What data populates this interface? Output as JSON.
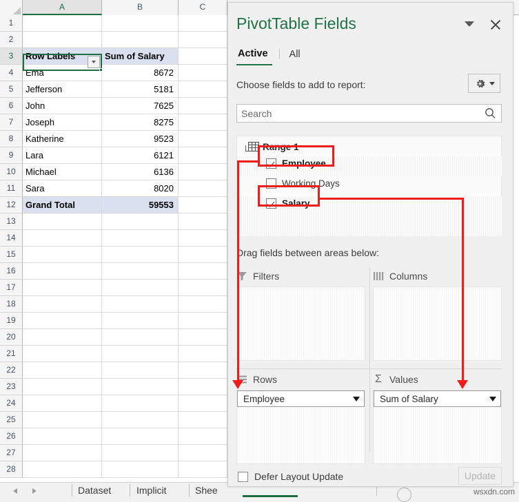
{
  "spreadsheet": {
    "columns": [
      "A",
      "B",
      "C"
    ],
    "active_column": "A",
    "active_row": "3",
    "rows": [
      "1",
      "2",
      "3",
      "4",
      "5",
      "6",
      "7",
      "8",
      "9",
      "10",
      "11",
      "12",
      "13",
      "14",
      "15",
      "16",
      "17",
      "18",
      "19",
      "20",
      "21",
      "22",
      "23",
      "24",
      "25",
      "26",
      "27",
      "28"
    ],
    "pivot_table": {
      "header_row": "3",
      "row_labels_header": "Row Labels",
      "value_header": "Sum of Salary",
      "records": [
        {
          "row": "4",
          "name": "Ema",
          "salary": "8672"
        },
        {
          "row": "5",
          "name": "Jefferson",
          "salary": "5181"
        },
        {
          "row": "6",
          "name": "John",
          "salary": "7625"
        },
        {
          "row": "7",
          "name": "Joseph",
          "salary": "8275"
        },
        {
          "row": "8",
          "name": "Katherine",
          "salary": "9523"
        },
        {
          "row": "9",
          "name": "Lara",
          "salary": "6121"
        },
        {
          "row": "10",
          "name": "Michael",
          "salary": "6136"
        },
        {
          "row": "11",
          "name": "Sara",
          "salary": "8020"
        }
      ],
      "grand_total_label": "Grand Total",
      "grand_total_value": "59553"
    }
  },
  "sheet_tabs": {
    "prev_icon": "nav-left-icon",
    "next_icon": "nav-right-icon",
    "tabs": [
      {
        "label": "Dataset",
        "active": false
      },
      {
        "label": "Implicit",
        "active": false
      },
      {
        "label": "Shee",
        "active": false
      }
    ]
  },
  "status_bar": {
    "watermark": "wsxdn.com"
  },
  "panel": {
    "title": "PivotTable Fields",
    "collapse_icon": "chevron-down-icon",
    "close_icon": "close-icon",
    "tabs": [
      {
        "label": "Active",
        "active": true
      },
      {
        "label": "All",
        "active": false
      }
    ],
    "choose_label": "Choose fields to add to report:",
    "tools_icon": "gear-icon",
    "tools_caret_icon": "chevron-down-icon",
    "search": {
      "placeholder": "Search",
      "value": "",
      "icon": "search-icon"
    },
    "field_list": {
      "source_name": "Range 1",
      "source_icon": "table-icon",
      "collapse_icon": "tree-collapse-icon",
      "fields": [
        {
          "label": "Employee",
          "checked": true,
          "highlighted": true
        },
        {
          "label": "Working Days",
          "checked": false,
          "highlighted": false
        },
        {
          "label": "Salary",
          "checked": true,
          "highlighted": true
        }
      ]
    },
    "drag_note": "Drag fields between areas below:",
    "areas": [
      {
        "key": "filters",
        "title": "Filters",
        "icon": "funnel-icon",
        "items": []
      },
      {
        "key": "columns",
        "title": "Columns",
        "icon": "columns-icon",
        "items": []
      },
      {
        "key": "rows",
        "title": "Rows",
        "icon": "rows-icon",
        "items": [
          {
            "label": "Employee",
            "caret": "chevron-down-icon"
          }
        ]
      },
      {
        "key": "values",
        "title": "Values",
        "icon": "sigma-icon",
        "items": [
          {
            "label": "Sum of Salary",
            "caret": "chevron-down-icon"
          }
        ]
      }
    ],
    "defer": {
      "label": "Defer Layout Update",
      "checked": false
    },
    "update_button": {
      "label": "Update",
      "enabled": false
    }
  },
  "annotations": {
    "color": "#ef1c1c",
    "highlight_boxes": [
      "Employee",
      "Salary"
    ],
    "arrows": [
      {
        "from": "Employee",
        "to": "Rows"
      },
      {
        "from": "Salary",
        "to": "Values"
      }
    ]
  },
  "colors": {
    "excel_green": "#217346",
    "pivot_header_fill": "#dae0f0",
    "annotation_red": "#ef1c1c"
  }
}
